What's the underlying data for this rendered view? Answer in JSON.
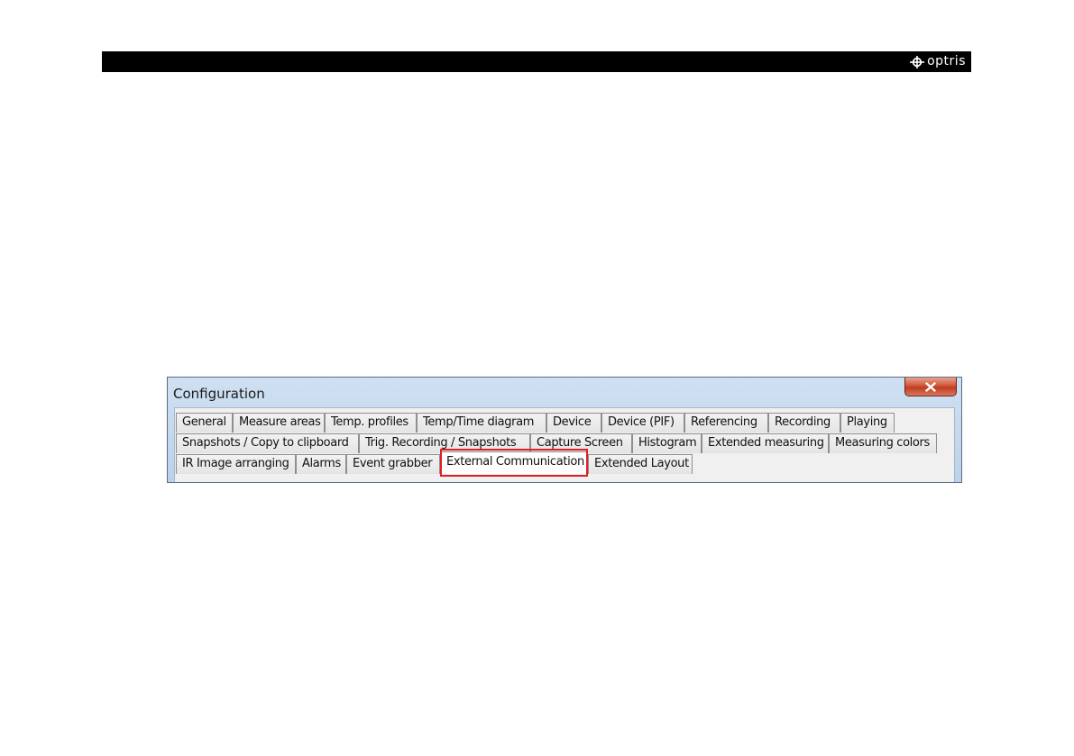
{
  "header": {
    "logo_text": "optris"
  },
  "window": {
    "title": "Configuration",
    "close_glyph": "x",
    "close_icon": "close-icon"
  },
  "tabs": {
    "row1": [
      "General",
      "Measure areas",
      "Temp. profiles",
      "Temp/Time diagram",
      "Device",
      "Device (PIF)",
      "Referencing",
      "Recording",
      "Playing"
    ],
    "row2": [
      "Snapshots / Copy to clipboard",
      "Trig. Recording / Snapshots",
      "Capture Screen",
      "Histogram",
      "Extended measuring",
      "Measuring colors"
    ],
    "row3": [
      "IR Image arranging",
      "Alarms",
      "Event grabber",
      "External Communication",
      "Extended Layout"
    ],
    "active": "External Communication"
  },
  "colors": {
    "highlight": "#e31e24",
    "header_bar": "#000000",
    "close_button": "#c13c20"
  }
}
